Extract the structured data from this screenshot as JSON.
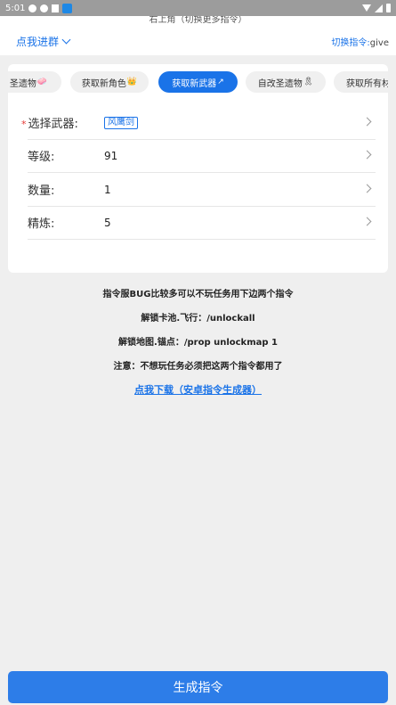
{
  "status_bar": {
    "time": "5:01"
  },
  "top_note": "右上角（切换更多指令）",
  "header": {
    "join_label": "点我进群",
    "switch_label": "切换指令:",
    "switch_value": "give"
  },
  "tabs": [
    {
      "label": "圣遗物",
      "icon": "🧼",
      "icon_name": "relic-icon",
      "active": false
    },
    {
      "label": "获取新角色",
      "icon": "👑",
      "icon_name": "crown-icon",
      "active": false
    },
    {
      "label": "获取新武器",
      "icon": "↗",
      "icon_name": "sword-icon",
      "active": true
    },
    {
      "label": "自改圣遗物",
      "icon": "🎗",
      "icon_name": "ribbon-icon",
      "active": false
    },
    {
      "label": "获取所有材",
      "icon": "",
      "icon_name": "",
      "active": false
    }
  ],
  "form": {
    "weapon": {
      "label": "选择武器:",
      "required_mark": "*",
      "value": "风鹰剑"
    },
    "level": {
      "label": "等级:",
      "value": "91"
    },
    "quantity": {
      "label": "数量:",
      "value": "1"
    },
    "refine": {
      "label": "精炼:",
      "value": "5"
    }
  },
  "notes": [
    "指令服BUG比较多可以不玩任务用下边两个指令",
    "解锁卡池.飞行：/unlockall",
    "解锁地图.锚点：/prop unlockmap 1",
    "注意：不想玩任务必须把这两个指令都用了"
  ],
  "download_link": "点我下载（安卓指令生成器）",
  "generate_button": "生成指令",
  "colors": {
    "accent": "#1a73e8",
    "button": "#2d7de8",
    "background": "#efefef",
    "required": "#e53935"
  }
}
